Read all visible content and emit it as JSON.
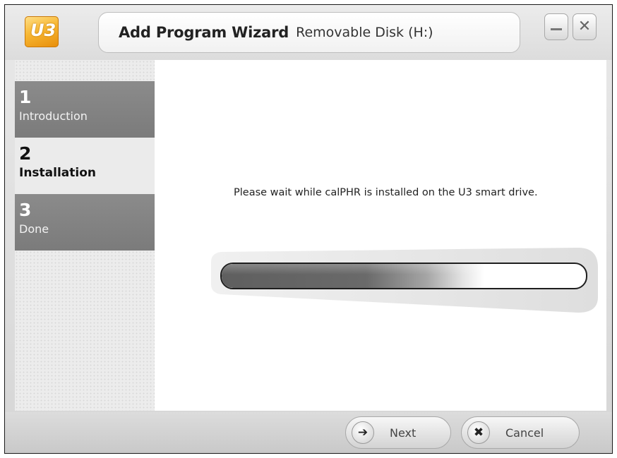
{
  "window": {
    "logo_text": "U3",
    "title": "Add Program Wizard",
    "subtitle": "Removable Disk (H:)",
    "minimize_symbol": "_",
    "close_symbol": "✕"
  },
  "steps": [
    {
      "number": "1",
      "label": "Introduction",
      "state": "inactive"
    },
    {
      "number": "2",
      "label": "Installation",
      "state": "active"
    },
    {
      "number": "3",
      "label": "Done",
      "state": "inactive"
    }
  ],
  "main": {
    "message": "Please wait while calPHR is installed on the U3 smart drive.",
    "progress_fraction": 0.72
  },
  "footer": {
    "next_label": "Next",
    "next_icon": "arrow-right-icon",
    "cancel_label": "Cancel",
    "cancel_icon": "x-icon"
  },
  "colors": {
    "sidebar_inactive": "#828282",
    "sidebar_active": "#ebebeb",
    "logo_orange": "#f7b733"
  }
}
